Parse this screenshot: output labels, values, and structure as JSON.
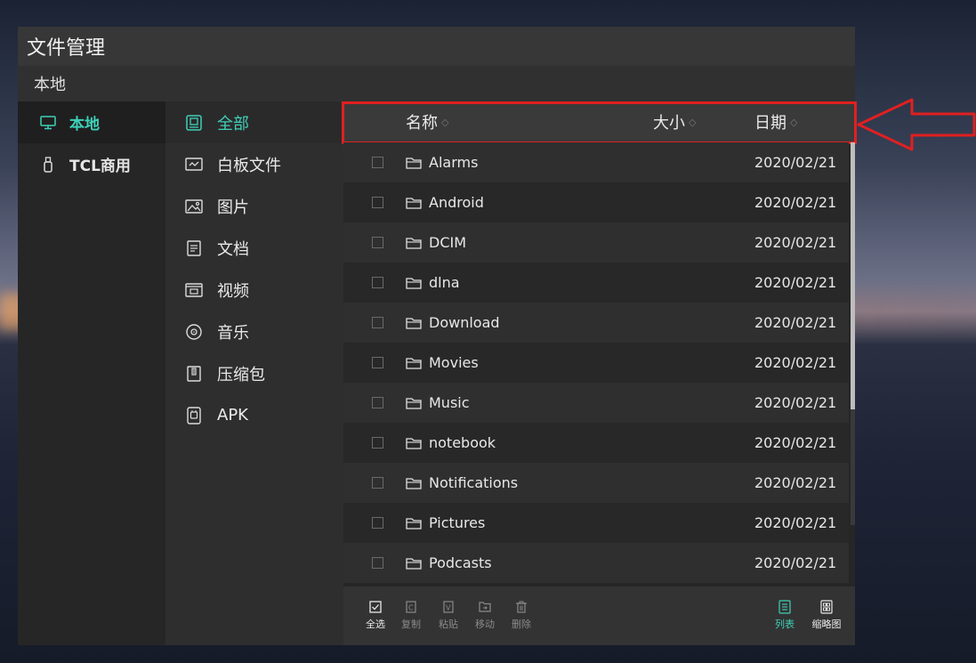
{
  "window": {
    "title": "文件管理"
  },
  "breadcrumb": "本地",
  "locations": [
    {
      "label": "本地",
      "icon": "monitor-icon",
      "active": true
    },
    {
      "label": "TCL商用",
      "icon": "usb-drive-icon",
      "active": false
    }
  ],
  "categories": [
    {
      "label": "全部",
      "icon": "all-files-icon",
      "active": true
    },
    {
      "label": "白板文件",
      "icon": "whiteboard-icon",
      "active": false
    },
    {
      "label": "图片",
      "icon": "image-icon",
      "active": false
    },
    {
      "label": "文档",
      "icon": "document-icon",
      "active": false
    },
    {
      "label": "视频",
      "icon": "video-icon",
      "active": false
    },
    {
      "label": "音乐",
      "icon": "music-icon",
      "active": false
    },
    {
      "label": "压缩包",
      "icon": "archive-icon",
      "active": false
    },
    {
      "label": "APK",
      "icon": "apk-icon",
      "active": false
    }
  ],
  "columns": {
    "name": "名称",
    "size": "大小",
    "date": "日期"
  },
  "files": [
    {
      "name": "Alarms",
      "date": "2020/02/21"
    },
    {
      "name": "Android",
      "date": "2020/02/21"
    },
    {
      "name": "DCIM",
      "date": "2020/02/21"
    },
    {
      "name": "dlna",
      "date": "2020/02/21"
    },
    {
      "name": "Download",
      "date": "2020/02/21"
    },
    {
      "name": "Movies",
      "date": "2020/02/21"
    },
    {
      "name": "Music",
      "date": "2020/02/21"
    },
    {
      "name": "notebook",
      "date": "2020/02/21"
    },
    {
      "name": "Notifications",
      "date": "2020/02/21"
    },
    {
      "name": "Pictures",
      "date": "2020/02/21"
    },
    {
      "name": "Podcasts",
      "date": "2020/02/21"
    }
  ],
  "toolbar": {
    "select_all": "全选",
    "copy": "复制",
    "paste": "粘贴",
    "move": "移动",
    "delete": "删除",
    "list_view": "列表",
    "thumbnail_view": "缩略图"
  },
  "colors": {
    "accent": "#3fd0b8",
    "annotation": "#e02020"
  }
}
